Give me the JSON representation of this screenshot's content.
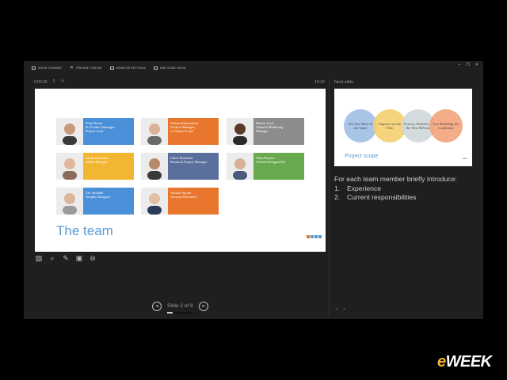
{
  "toolbar": {
    "items": [
      "SHOW TASKBAR",
      "PRESENT ONLINE",
      "MONITOR SETTINGS",
      "END SLIDE SHOW"
    ]
  },
  "window_controls": [
    "–",
    "❐",
    "✕"
  ],
  "presenter": {
    "timer": "0:00:25",
    "pause_icon": "‖",
    "restart_icon": "↻",
    "clock": "10:10",
    "next_slide_label": "Next slide"
  },
  "current_slide": {
    "title": "The team",
    "members": [
      {
        "name": "Toby Nixon",
        "role": "Sr. Product Manager,",
        "role2": "Project Lead",
        "color": "#4a90d9"
      },
      {
        "name": "Nathan Kaminaletta",
        "role": "Product Manager,",
        "role2": "Co Project Lead",
        "color": "#e8762c"
      },
      {
        "name": "Rianna Lord",
        "role": "Channel Marketing",
        "role2": "Manager",
        "color": "#8c8c8c"
      },
      {
        "name": "Annie Herriman",
        "role": "Media Manager",
        "role2": "",
        "color": "#f2b632"
      },
      {
        "name": "Chloe Brouhard",
        "role": "Research Project Manager",
        "role2": "",
        "color": "#5a6f9c"
      },
      {
        "name": "Chris Boyton",
        "role": "Content Designer/Ed",
        "role2": "",
        "color": "#6aaa4f"
      },
      {
        "name": "Zac Woodall",
        "role": "Graphic Designer",
        "role2": "",
        "color": "#4a90d9"
      },
      {
        "name": "Aimilar Sporta",
        "role": "Account Executive",
        "role2": "",
        "color": "#e8762c"
      }
    ],
    "dot_colors": [
      "#e8762c",
      "#5b9bd5",
      "#5b9bd5",
      "#5b9bd5"
    ]
  },
  "next_slide": {
    "title": "Project scope",
    "circles": [
      {
        "text": "Not Just More of the Same",
        "color": "#9fbfe6"
      },
      {
        "text": "Improve on the Past",
        "color": "#f4d06f"
      },
      {
        "text": "Convey Benefits of the New Release",
        "color": "#cfd8dc"
      },
      {
        "text": "Use Branding for Continuity",
        "color": "#f4a47c"
      }
    ],
    "more": "•••"
  },
  "notes": {
    "intro": "For each team member briefly introduce:",
    "items": [
      {
        "num": "1.",
        "text": "Experience"
      },
      {
        "num": "2.",
        "text": "Current responsibilities"
      }
    ]
  },
  "tools": [
    "▧",
    "⌕",
    "✎",
    "▣",
    "⊖"
  ],
  "navigation": {
    "prev": "◂",
    "next": "▸",
    "text": "Slide 2 of 9",
    "progress": 0.22
  },
  "resize": [
    "↙",
    "↗"
  ],
  "logo": {
    "e": "e",
    "rest": "WEEK"
  }
}
